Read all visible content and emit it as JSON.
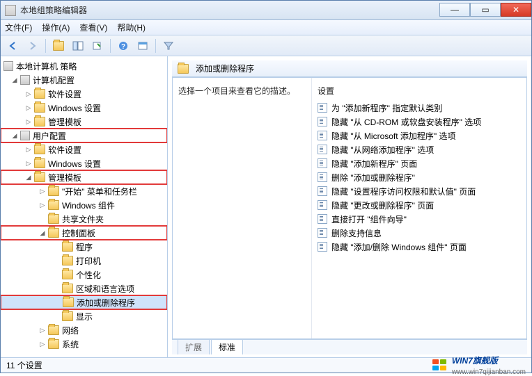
{
  "window": {
    "title": "本地组策略编辑器"
  },
  "menu": {
    "file": "文件(F)",
    "action": "操作(A)",
    "view": "查看(V)",
    "help": "帮助(H)"
  },
  "tree": {
    "root": "本地计算机 策略",
    "computer_config": "计算机配置",
    "cc_software": "软件设置",
    "cc_windows": "Windows 设置",
    "cc_admin": "管理模板",
    "user_config": "用户配置",
    "uc_software": "软件设置",
    "uc_windows": "Windows 设置",
    "uc_admin": "管理模板",
    "start_taskbar": "\"开始\" 菜单和任务栏",
    "win_components": "Windows 组件",
    "shared_folders": "共享文件夹",
    "control_panel": "控制面板",
    "programs": "程序",
    "printers": "打印机",
    "personalization": "个性化",
    "region_lang": "区域和语言选项",
    "add_remove_programs": "添加或删除程序",
    "display": "显示",
    "network": "网络",
    "system": "系统"
  },
  "right": {
    "header": "添加或删除程序",
    "desc_prompt": "选择一个项目来查看它的描述。",
    "settings_header": "设置",
    "settings": [
      "为 \"添加新程序\" 指定默认类别",
      "隐藏 \"从 CD-ROM 或软盘安装程序\" 选项",
      "隐藏 \"从 Microsoft 添加程序\" 选项",
      "隐藏 \"从网络添加程序\" 选项",
      "隐藏 \"添加新程序\" 页面",
      "删除 \"添加或删除程序\"",
      "隐藏 \"设置程序访问权限和默认值\" 页面",
      "隐藏 \"更改或删除程序\" 页面",
      "直接打开 \"组件向导\"",
      "删除支持信息",
      "隐藏 \"添加/删除 Windows 组件\" 页面"
    ]
  },
  "tabs": {
    "extended": "扩展",
    "standard": "标准"
  },
  "status": {
    "count": "11 个设置"
  },
  "brand": {
    "name": "WIN7旗舰版",
    "url": "www.win7qijianban.com"
  }
}
